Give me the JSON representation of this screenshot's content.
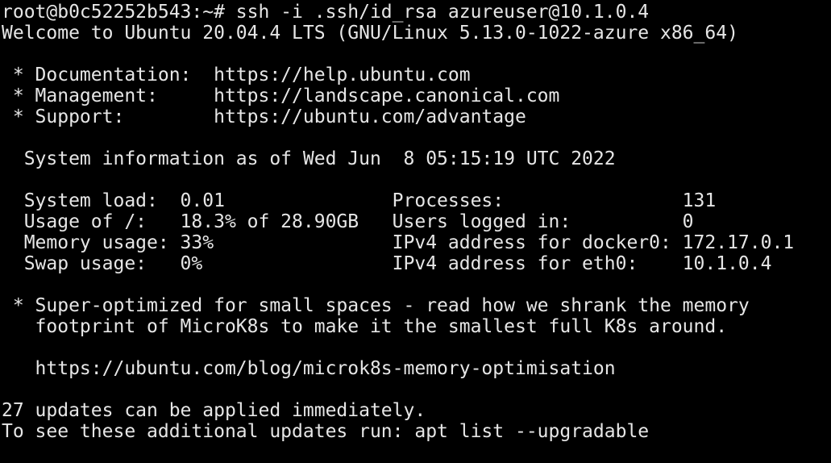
{
  "terminal": {
    "colors": {
      "background": "#000000",
      "foreground": "#e6e6e6"
    },
    "lines": [
      "root@b0c52252b543:~# ssh -i .ssh/id_rsa azureuser@10.1.0.4",
      "Welcome to Ubuntu 20.04.4 LTS (GNU/Linux 5.13.0-1022-azure x86_64)",
      "",
      " * Documentation:  https://help.ubuntu.com",
      " * Management:     https://landscape.canonical.com",
      " * Support:        https://ubuntu.com/advantage",
      "",
      "  System information as of Wed Jun  8 05:15:19 UTC 2022",
      "",
      "  System load:  0.01               Processes:                131",
      "  Usage of /:   18.3% of 28.90GB   Users logged in:          0",
      "  Memory usage: 33%                IPv4 address for docker0: 172.17.0.1",
      "  Swap usage:   0%                 IPv4 address for eth0:    10.1.0.4",
      "",
      " * Super-optimized for small spaces - read how we shrank the memory",
      "   footprint of MicroK8s to make it the smallest full K8s around.",
      "",
      "   https://ubuntu.com/blog/microk8s-memory-optimisation",
      "",
      "27 updates can be applied immediately.",
      "To see these additional updates run: apt list --upgradable"
    ]
  }
}
